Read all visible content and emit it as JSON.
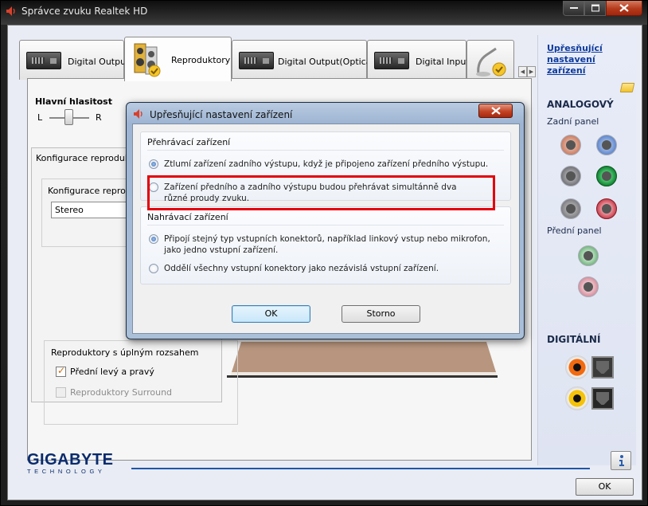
{
  "window": {
    "title": "Správce zvuku Realtek HD"
  },
  "tabs": [
    {
      "label": "Digital Output",
      "icon": "digital-device-icon",
      "active": false
    },
    {
      "label": "Reproduktory",
      "icon": "speakers-icon",
      "active": true
    },
    {
      "label": "Digital Output(Optical)",
      "icon": "digital-device-icon",
      "active": false
    },
    {
      "label": "Digital Input",
      "icon": "digital-device-icon",
      "active": false
    }
  ],
  "tabpage": {
    "volume_label": "Hlavní hlasitost",
    "left": "L",
    "right": "R",
    "config_group_title": "Konfigurace reproduktorů",
    "config_sub_label": "Konfigurace reproduktorů",
    "config_select_value": "Stereo",
    "fullrange_title": "Reproduktory s úplným rozsahem",
    "fullrange_front": "Přední levý a pravý",
    "fullrange_front_checked": true,
    "fullrange_surround": "Reproduktory Surround",
    "fullrange_surround_checked": false
  },
  "right_panel": {
    "advanced_link": "Upřesňující nastavení zařízení",
    "analog_heading": "ANALOGOVÝ",
    "rear_panel": "Zadní panel",
    "front_panel": "Přední panel",
    "digital_heading": "DIGITÁLNÍ",
    "jack_colors": {
      "rear": [
        "#c87a60",
        "#5b82c8",
        "#6d6d72",
        "#0d7a2e",
        "#7a7a7e",
        "#c23a48"
      ],
      "front": [
        "#6fb07a",
        "#d18a98"
      ]
    }
  },
  "footer": {
    "brand": "GIGABYTE",
    "brand_sub": "TECHNOLOGY",
    "ok_label": "OK"
  },
  "dialog": {
    "title": "Upřesňující nastavení zařízení",
    "playback_title": "Přehrávací zařízení",
    "playback_options": [
      {
        "label": "Ztlumí zařízení zadního výstupu, když je připojeno zařízení předního výstupu.",
        "selected": true
      },
      {
        "label": "Zařízení předního a zadního výstupu budou přehrávat simultánně dva různé proudy zvuku.",
        "selected": false
      }
    ],
    "record_title": "Nahrávací zařízení",
    "record_options": [
      {
        "label": "Připojí stejný typ vstupních konektorů, například linkový vstup nebo mikrofon, jako jedno vstupní zařízení.",
        "selected": true
      },
      {
        "label": "Oddělí všechny vstupní konektory jako nezávislá vstupní zařízení.",
        "selected": false
      }
    ],
    "ok_label": "OK",
    "cancel_label": "Storno",
    "highlight_color": "#e3000b"
  }
}
